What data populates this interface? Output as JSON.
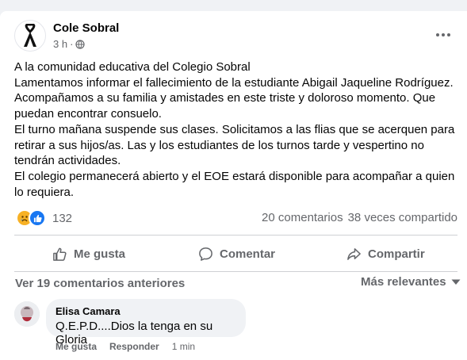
{
  "post": {
    "page_name": "Cole Sobral",
    "time": "3 h",
    "separator": "·",
    "text": "A la comunidad educativa del Colegio Sobral\nLamentamos informar el fallecimiento de la estudiante Abigail Jaqueline Rodríguez.\nAcompañamos a su familia y amistades en este triste y doloroso momento. Que puedan encontrar consuelo.\nEl turno mañana suspende sus clases. Solicitamos a las flias que se acerquen para retirar a sus hijos/as. Las y los estudiantes de los turnos tarde y vespertino no tendrán actividades.\nEl colegio permanecerá abierto y el EOE estará disponible para acompañar a quien lo requiera."
  },
  "reactions": {
    "icons": [
      "sad-reaction",
      "like-reaction"
    ],
    "count": "132",
    "comments": "20 comentarios",
    "shares": "38 veces compartido"
  },
  "actions": {
    "like": "Me gusta",
    "comment": "Comentar",
    "share": "Compartir"
  },
  "comments": {
    "previous_label": "Ver 19 comentarios anteriores",
    "sort_label": "Más relevantes",
    "items": [
      {
        "author": "Elisa Camara",
        "text": "Q.E.P.D....Dios la tenga en su Gloria",
        "like": "Me gusta",
        "reply": "Responder",
        "time": "1 min"
      }
    ]
  },
  "colors": {
    "secondary_text": "#65676b",
    "like_blue": "#1877f2",
    "sad_yellow": "#f7b125"
  }
}
